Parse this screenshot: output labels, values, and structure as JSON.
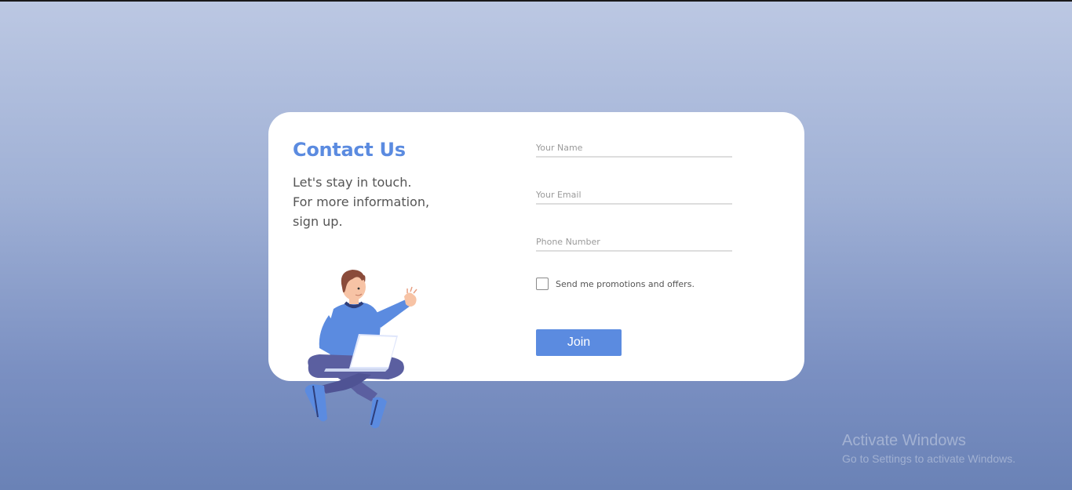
{
  "contact": {
    "title": "Contact Us",
    "subtitle_lines": [
      "Let's stay in touch.",
      "For more information,",
      "sign up."
    ]
  },
  "form": {
    "name_placeholder": "Your Name",
    "email_placeholder": "Your Email",
    "phone_placeholder": "Phone Number",
    "promo_label": "Send me promotions and offers.",
    "promo_checked": false,
    "join_label": "Join"
  },
  "watermark": {
    "title": "Activate Windows",
    "subtitle": "Go to Settings to activate Windows."
  },
  "colors": {
    "accent": "#5b8be0",
    "card_bg": "#ffffff",
    "text_muted": "#555555"
  }
}
